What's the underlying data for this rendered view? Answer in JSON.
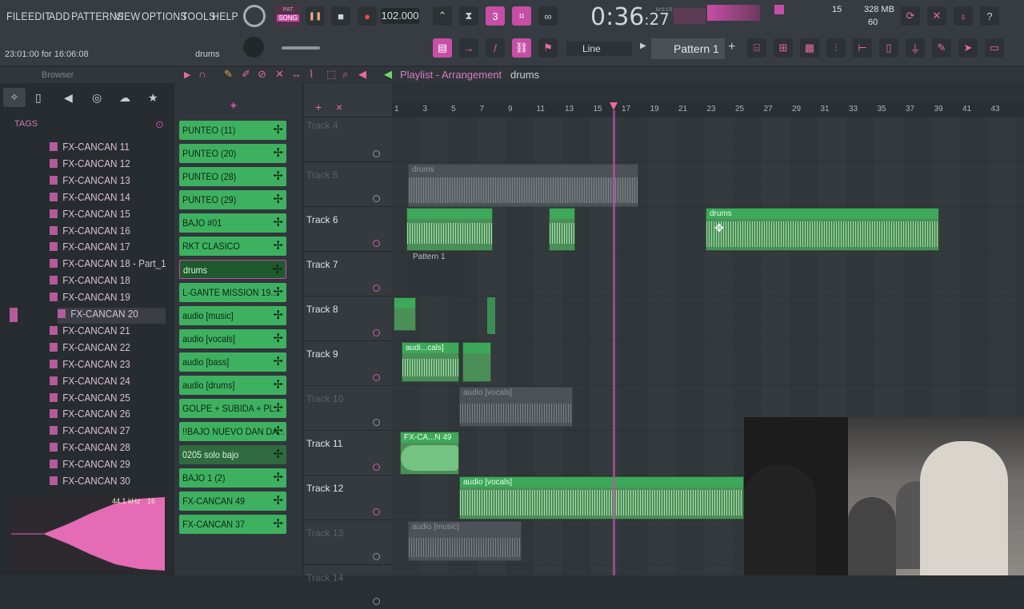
{
  "menu": [
    "FILE",
    "EDIT",
    "ADD",
    "PATTERNS",
    "VIEW",
    "OPTIONS",
    "TOOLS",
    "HELP"
  ],
  "transport": {
    "mode_top": "PAT",
    "mode_bottom": "SONG",
    "tempo": "102.000",
    "time": "0:36",
    "time_sub": "27",
    "time_label": "M:S:CS"
  },
  "system": {
    "cpu_label": "15",
    "ram": "328 MB",
    "poly": "60"
  },
  "hint_text": "23:01:00 for 16:06:08",
  "hint_target": "drums",
  "snap": {
    "value": "Line"
  },
  "pattern_selector": "Pattern 1",
  "playlist": {
    "title": "Playlist - Arrangement",
    "crumb": "drums"
  },
  "browser": {
    "title": "Browser",
    "tags_label": "TAGS",
    "files": [
      "FX-CANCAN  11",
      "FX-CANCAN  12",
      "FX-CANCAN  13",
      "FX-CANCAN  14",
      "FX-CANCAN  15",
      "FX-CANCAN  16",
      "FX-CANCAN  17",
      "FX-CANCAN  18 - Part_1",
      "FX-CANCAN  18",
      "FX-CANCAN  19",
      "FX-CANCAN  20",
      "FX-CANCAN  21",
      "FX-CANCAN  22",
      "FX-CANCAN  23",
      "FX-CANCAN  24",
      "FX-CANCAN  25",
      "FX-CANCAN  26",
      "FX-CANCAN  27",
      "FX-CANCAN  28",
      "FX-CANCAN  29",
      "FX-CANCAN  30"
    ],
    "preview_rate": "44.1 kHz",
    "preview_bits": "16"
  },
  "channels": [
    "PUNTEO (11)",
    "PUNTEO (20)",
    "PUNTEO (28)",
    "PUNTEO (29)",
    "BAJO #01",
    "RKT CLASICO",
    "drums",
    "L-GANTE MISSION 19...",
    "audio [music]",
    "audio [vocals]",
    "audio [bass]",
    "audio [drums]",
    "GOLPE + SUBIDA + PL...",
    "!!BAJO NUEVO DAN DA...",
    "0205 solo bajo",
    "BAJO 1 (2)",
    "FX-CANCAN  49",
    "FX-CANCAN  37"
  ],
  "ruler": [
    "1",
    "3",
    "5",
    "7",
    "9",
    "11",
    "13",
    "15",
    "17",
    "19",
    "21",
    "23",
    "25",
    "27",
    "29",
    "31",
    "33",
    "35",
    "37",
    "39",
    "41",
    "43"
  ],
  "tracks": [
    "Track 4",
    "Track 5",
    "Track 6",
    "Track 7",
    "Track 8",
    "Track 9",
    "Track 10",
    "Track 11",
    "Track 12",
    "Track 13",
    "Track 14"
  ],
  "clips": {
    "t5": "drums",
    "t6a": "",
    "t6b": "",
    "t6c": "drums",
    "t7": "Pattern 1",
    "t9": "audi...cals]",
    "t10": "audio [vocals]",
    "t11": "FX-CA...N  49",
    "t12": "audio [vocals]",
    "t13": "audio [music]"
  },
  "colors": {
    "accent": "#d05aa8",
    "clip_green": "#3eb160",
    "bg": "#2a2f33"
  }
}
